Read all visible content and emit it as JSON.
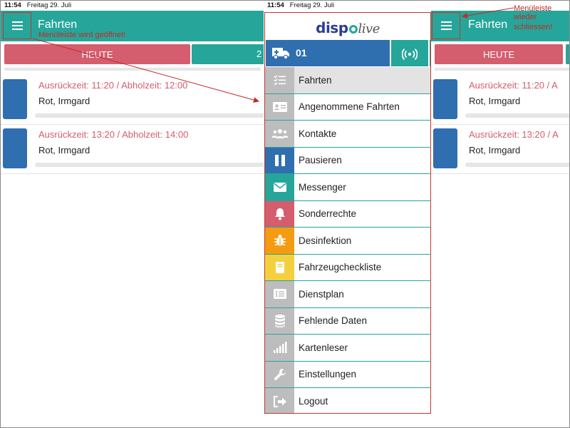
{
  "status": {
    "time": "11:54",
    "date": "Freitag 29. Juli"
  },
  "appbar": {
    "title": "Fahrten"
  },
  "annotations": {
    "opened": "Menüleiste wird geöffnet!",
    "close_l1": "Menüleiste",
    "close_l2": "wieder",
    "close_l3": "schliessen!"
  },
  "tabs": {
    "today": "HEUTE",
    "next_partial": "2"
  },
  "trips": [
    {
      "time": "Ausrückzeit: 11:20 / Abholzeit: 12:00",
      "name": "Rot, Irmgard"
    },
    {
      "time": "Ausrückzeit: 13:20 / Abholzeit: 14:00",
      "name": "Rot, Irmgard"
    }
  ],
  "trips_truncated": [
    {
      "time": "Ausrückzeit: 11:20 / A",
      "name": "Rot, Irmgard"
    },
    {
      "time": "Ausrückzeit: 13:20 / A",
      "name": "Rot, Irmgard"
    }
  ],
  "drawer": {
    "logo_a": "disp",
    "logo_b": "live",
    "vehicle_number": "01",
    "items": [
      {
        "label": "Fahrten",
        "icon": "checklist-icon",
        "color": "#bdbdbd"
      },
      {
        "label": "Angenommene Fahrten",
        "icon": "id-card-icon",
        "color": "#bdbdbd"
      },
      {
        "label": "Kontakte",
        "icon": "group-icon",
        "color": "#bdbdbd"
      },
      {
        "label": "Pausieren",
        "icon": "pause-icon",
        "color": "#2f6fb0"
      },
      {
        "label": "Messenger",
        "icon": "mail-icon",
        "color": "#26a69a"
      },
      {
        "label": "Sonderrechte",
        "icon": "bell-icon",
        "color": "#d45d6e"
      },
      {
        "label": "Desinfektion",
        "icon": "bug-icon",
        "color": "#f39c12"
      },
      {
        "label": "Fahrzeugcheckliste",
        "icon": "book-icon",
        "color": "#f4d03f"
      },
      {
        "label": "Dienstplan",
        "icon": "list-icon",
        "color": "#bdbdbd"
      },
      {
        "label": "Fehlende Daten",
        "icon": "database-icon",
        "color": "#bdbdbd"
      },
      {
        "label": "Kartenleser",
        "icon": "signal-bars-icon",
        "color": "#bdbdbd"
      },
      {
        "label": "Einstellungen",
        "icon": "wrench-icon",
        "color": "#bdbdbd"
      },
      {
        "label": "Logout",
        "icon": "logout-icon",
        "color": "#bdbdbd"
      }
    ]
  },
  "colors": {
    "teal": "#26a69a",
    "red": "#d45d6e",
    "blue": "#2f6fb0",
    "annotation": "#c62828"
  }
}
